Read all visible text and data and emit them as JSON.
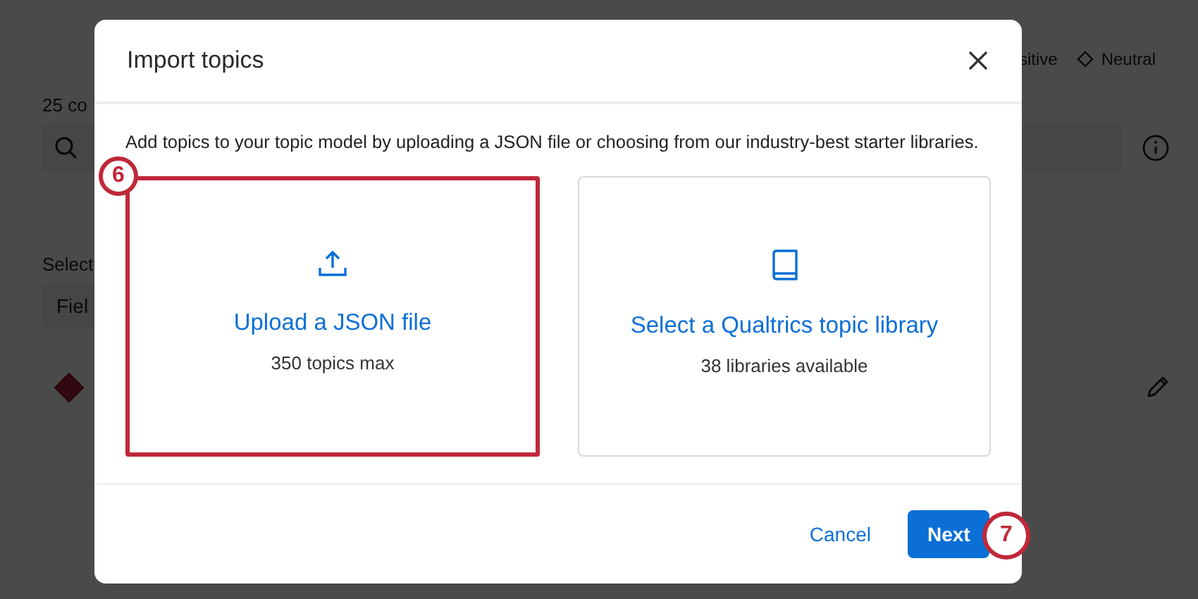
{
  "background": {
    "legend": [
      {
        "label": "sitive",
        "kind": "text"
      },
      {
        "label": "Neutral",
        "kind": "diamond"
      }
    ],
    "count_text": "25 co",
    "select_label": "Select",
    "field_button": "Fiel"
  },
  "dialog": {
    "title": "Import topics",
    "description": "Add topics to your topic model by uploading a JSON file or choosing from our industry-best starter libraries.",
    "options": [
      {
        "kind": "upload",
        "title": "Upload a JSON file",
        "subtitle": "350 topics max",
        "highlighted": true,
        "callout": "6"
      },
      {
        "kind": "library",
        "title": "Select a Qualtrics topic library",
        "subtitle": "38 libraries available",
        "highlighted": false
      }
    ],
    "buttons": [
      {
        "label": "Cancel",
        "kind": "link"
      },
      {
        "label": "Next",
        "kind": "primary",
        "callout": "7"
      }
    ]
  }
}
